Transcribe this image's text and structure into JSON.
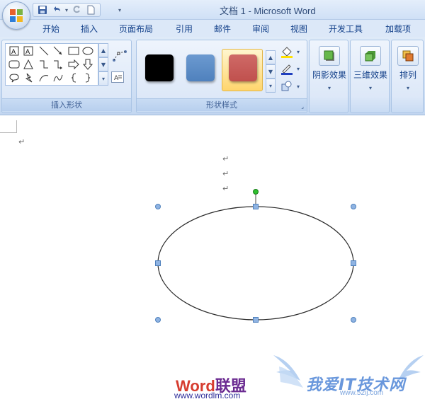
{
  "window": {
    "title": "文档 1 - Microsoft Word"
  },
  "quick_access": {
    "icons": [
      "save-icon",
      "undo-icon",
      "redo-icon",
      "new-document-icon",
      "customize-icon"
    ]
  },
  "tabs": [
    {
      "label": "开始"
    },
    {
      "label": "插入"
    },
    {
      "label": "页面布局"
    },
    {
      "label": "引用"
    },
    {
      "label": "邮件"
    },
    {
      "label": "审阅"
    },
    {
      "label": "视图"
    },
    {
      "label": "开发工具"
    },
    {
      "label": "加载项"
    }
  ],
  "ribbon": {
    "insert_shapes": {
      "label": "插入形状",
      "shapes": [
        "text-box-icon",
        "vertical-text-box-icon",
        "line-icon",
        "arrow-line-icon",
        "rectangle-icon",
        "oval-icon",
        "rounded-rectangle-icon",
        "triangle-icon",
        "elbow-connector-icon",
        "elbow-arrow-icon",
        "right-arrow-icon",
        "down-arrow-icon",
        "callout-icon",
        "lightning-icon",
        "arc-icon",
        "curve-icon",
        "left-brace-icon",
        "right-brace-icon"
      ]
    },
    "shape_styles": {
      "label": "形状样式",
      "swatches": [
        "#000000",
        "#4f81bd",
        "#c0504d"
      ],
      "tools": [
        "fill-bucket-icon",
        "pen-color-icon",
        "change-shape-icon"
      ]
    },
    "shadow_effects": {
      "label": "阴影效果"
    },
    "threed_effects": {
      "label": "三维效果"
    },
    "arrange": {
      "label": "排列"
    }
  },
  "document": {
    "paragraph_mark": "↵"
  },
  "watermarks": {
    "left_brand_word": "Word",
    "left_brand_cn": "联盟",
    "left_url": "www.wordlm.com",
    "right_text": "我爱IT技术网",
    "right_url": "www.52ij.com"
  },
  "colors": {
    "selection_handle": "#4f81bd",
    "rotation_handle": "#2ec02e",
    "accent_tab_text": "#15428b"
  }
}
